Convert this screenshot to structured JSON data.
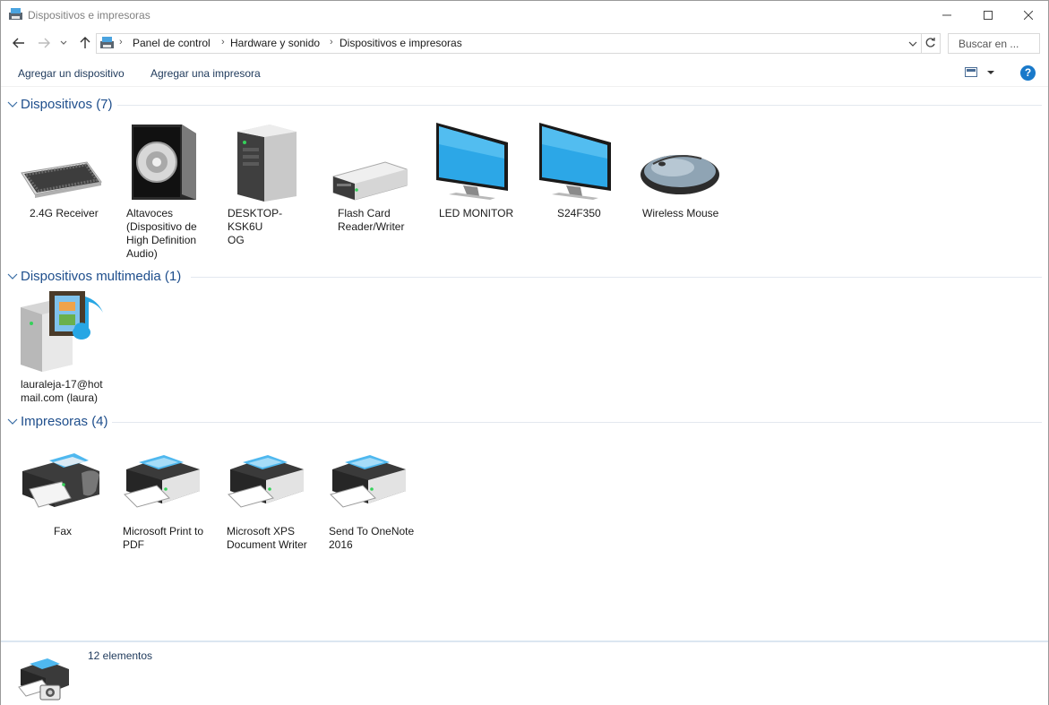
{
  "window": {
    "title": "Dispositivos e impresoras"
  },
  "address": {
    "crumbs": [
      "Panel de control",
      "Hardware y sonido",
      "Dispositivos e impresoras"
    ]
  },
  "search": {
    "placeholder": "Buscar en ..."
  },
  "toolbar": {
    "add_device": "Agregar un dispositivo",
    "add_printer": "Agregar una impresora"
  },
  "groups": {
    "devices": {
      "title": "Dispositivos (7)",
      "items": [
        {
          "label": "2.4G Receiver",
          "icon": "keyboard-icon"
        },
        {
          "label": "Altavoces\n(Dispositivo de\nHigh Definition\nAudio)",
          "icon": "speaker-icon"
        },
        {
          "label": "DESKTOP-KSK6U\nOG",
          "icon": "computer-tower-icon"
        },
        {
          "label": "Flash Card\nReader/Writer",
          "icon": "card-reader-icon"
        },
        {
          "label": "LED MONITOR",
          "icon": "monitor-icon"
        },
        {
          "label": "S24F350",
          "icon": "monitor-icon"
        },
        {
          "label": "Wireless Mouse",
          "icon": "mouse-icon"
        }
      ]
    },
    "multimedia": {
      "title": "Dispositivos multimedia (1)",
      "items": [
        {
          "label": "lauraleja-17@hot\nmail.com (laura)",
          "icon": "media-server-icon"
        }
      ]
    },
    "printers": {
      "title": "Impresoras (4)",
      "items": [
        {
          "label": "Fax",
          "icon": "fax-icon"
        },
        {
          "label": "Microsoft Print to\nPDF",
          "icon": "printer-icon"
        },
        {
          "label": "Microsoft XPS\nDocument Writer",
          "icon": "printer-icon"
        },
        {
          "label": "Send To OneNote\n2016",
          "icon": "printer-icon"
        }
      ]
    }
  },
  "status": {
    "count": "12 elementos"
  },
  "colors": {
    "accent": "#1e4e8c",
    "link": "#1e395b",
    "help": "#1979ca"
  }
}
